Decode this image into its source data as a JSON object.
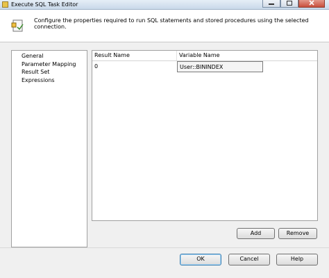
{
  "window": {
    "title": "Execute SQL Task Editor"
  },
  "banner": {
    "text": "Configure the properties required to run SQL statements and stored procedures using the selected connection."
  },
  "nav": {
    "items": [
      "General",
      "Parameter Mapping",
      "Result Set",
      "Expressions"
    ]
  },
  "result_set": {
    "columns": [
      "Result Name",
      "Variable Name"
    ],
    "rows": [
      {
        "result_name": "0",
        "variable_name": "User::BININDEX"
      }
    ]
  },
  "buttons": {
    "add": "Add",
    "remove": "Remove",
    "ok": "OK",
    "cancel": "Cancel",
    "help": "Help"
  },
  "icons": {
    "window": "sql-task-icon",
    "banner": "task-editor-icon"
  }
}
